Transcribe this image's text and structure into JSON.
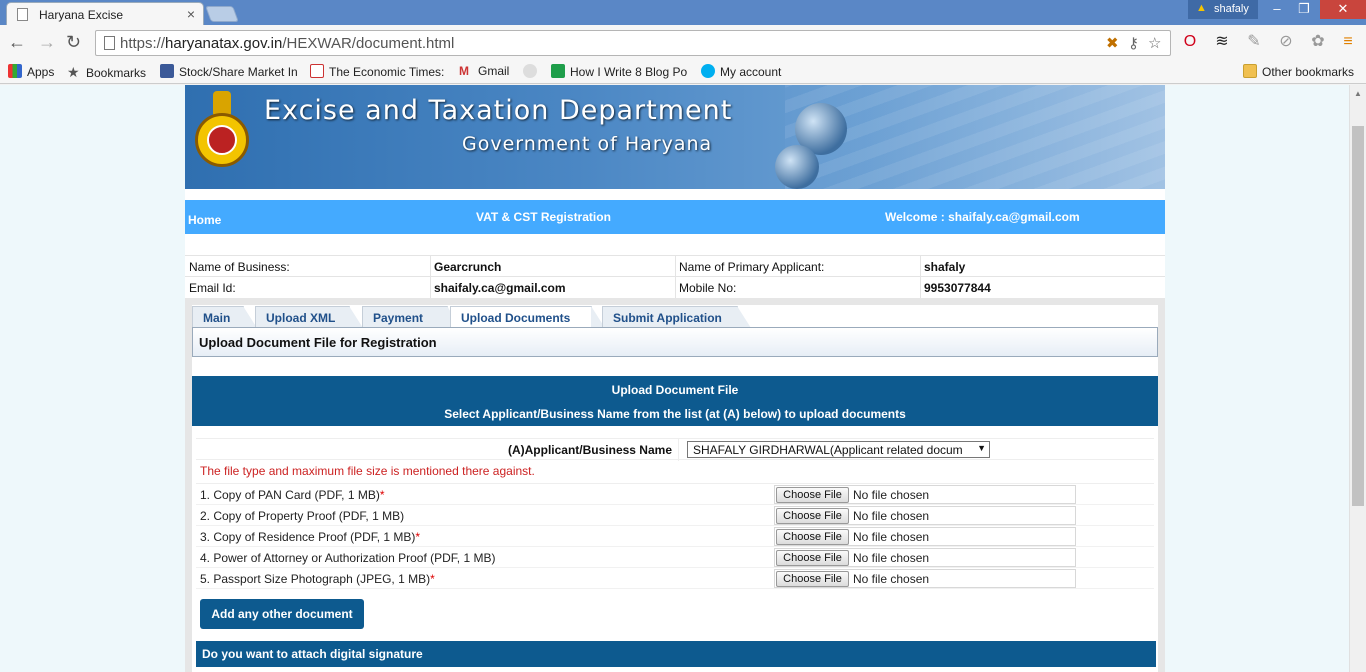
{
  "browser": {
    "tab_title": "Haryana Excise",
    "tab_close": "×",
    "user_name": "shafaly",
    "url_prefix": "https://",
    "url_host": "haryanatax.gov.in",
    "url_path": "/HEXWAR/document.html",
    "bookmarks": {
      "apps": "Apps",
      "bookmarks": "Bookmarks",
      "stock": "Stock/Share Market In",
      "et": "The Economic Times:",
      "gmail": "Gmail",
      "blog": "How I Write 8 Blog Po",
      "account": "My account",
      "other": "Other bookmarks"
    }
  },
  "header": {
    "title": "Excise and Taxation Department",
    "subtitle": "Government of Haryana"
  },
  "nav": {
    "home": "Home",
    "section": "VAT & CST Registration",
    "welcome": "Welcome : shaifaly.ca@gmail.com"
  },
  "info": {
    "business_label": "Name of Business:",
    "business_value": "Gearcrunch",
    "applicant_label": "Name of Primary Applicant:",
    "applicant_value": "shafaly",
    "email_label": "Email Id:",
    "email_value": "shaifaly.ca@gmail.com",
    "mobile_label": "Mobile No:",
    "mobile_value": "9953077844"
  },
  "tabs": [
    "Main",
    "Upload XML",
    "Payment",
    "Upload Documents",
    "Submit Application"
  ],
  "panel_title": "Upload Document File for Registration",
  "upload": {
    "heading": "Upload Document File",
    "subheading": "Select Applicant/Business Name from the list (at (A) below) to upload documents",
    "select_label": "(A)Applicant/Business Name",
    "select_value": "SHAFALY GIRDHARWAL(Applicant related docum",
    "note": "The file type and maximum file size is mentioned there against.",
    "documents": [
      {
        "label": "1. Copy of PAN Card (PDF, 1 MB)",
        "required": "*"
      },
      {
        "label": "2. Copy of Property Proof (PDF, 1 MB)",
        "required": ""
      },
      {
        "label": "3. Copy of Residence Proof (PDF, 1 MB)",
        "required": "*"
      },
      {
        "label": "4. Power of Attorney or Authorization Proof (PDF, 1 MB)",
        "required": ""
      },
      {
        "label": "5. Passport Size Photograph (JPEG, 1 MB)",
        "required": "*"
      }
    ],
    "choose_file": "Choose File",
    "no_file": "No file chosen",
    "add_button": "Add any other document",
    "signature_heading": "Do you want to attach digital signature"
  }
}
